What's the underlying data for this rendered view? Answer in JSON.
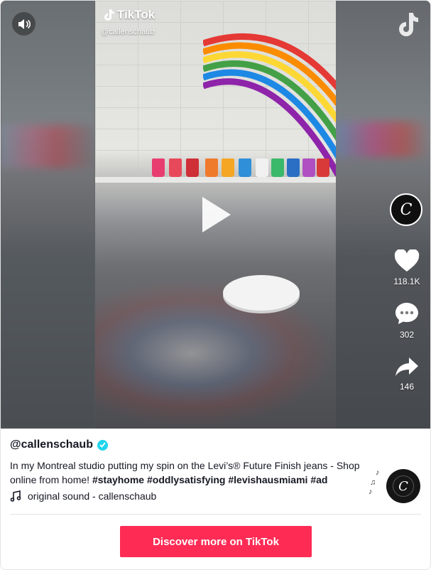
{
  "brand": {
    "name": "TikTok",
    "handle": "@callenschaub"
  },
  "stats": {
    "likes": "118.1K",
    "comments": "302",
    "shares": "146"
  },
  "post": {
    "author": "@callenschaub",
    "caption_text": "In my Montreal studio putting my spin on the Levi’s® Future Finish jeans - Shop online from home!",
    "hashtags": [
      "#stayhome",
      "#oddlysatisfying",
      "#levishausmiami",
      "#ad"
    ],
    "sound": "original sound - callenschaub"
  },
  "cta": {
    "label": "Discover more on TikTok"
  },
  "icons": [
    "sound-icon",
    "tiktok-logo-icon",
    "play-icon",
    "heart-icon",
    "comment-icon",
    "share-icon",
    "verified-icon",
    "music-note-icon"
  ],
  "colors": {
    "accent": "#fe2c55",
    "verified": "#20d5ec",
    "text": "#161823"
  }
}
